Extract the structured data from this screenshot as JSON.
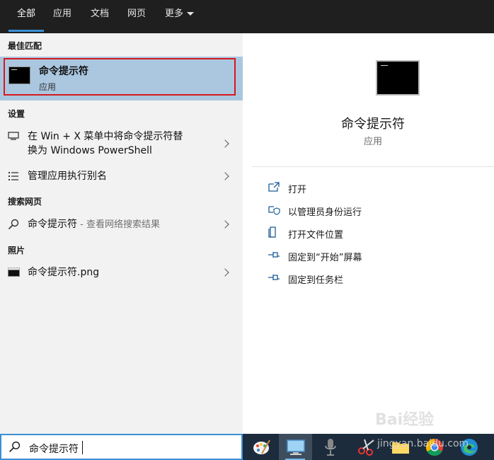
{
  "tabs": [
    {
      "label": "全部",
      "active": true
    },
    {
      "label": "应用"
    },
    {
      "label": "文档"
    },
    {
      "label": "网页"
    },
    {
      "label": "更多"
    }
  ],
  "sections": {
    "best_match": "最佳匹配",
    "settings": "设置",
    "web_search": "搜索网页",
    "photos": "照片"
  },
  "best_match": {
    "title": "命令提示符",
    "subtitle": "应用"
  },
  "settings_items": [
    {
      "line1": "在 Win + X 菜单中将命令提示符替",
      "line2": "换为 Windows PowerShell"
    },
    {
      "line1": "管理应用执行别名"
    }
  ],
  "web_item": {
    "label": "命令提示符",
    "hint": " - 查看网络搜索结果"
  },
  "photo_item": {
    "label": "命令提示符.png"
  },
  "preview": {
    "title": "命令提示符",
    "subtitle": "应用",
    "actions": [
      {
        "label": "打开",
        "icon": "open-icon"
      },
      {
        "label": "以管理员身份运行",
        "icon": "shield-icon"
      },
      {
        "label": "打开文件位置",
        "icon": "file-location-icon"
      },
      {
        "label": "固定到“开始”屏幕",
        "icon": "pin-icon"
      },
      {
        "label": "固定到任务栏",
        "icon": "pin-icon"
      }
    ]
  },
  "search": {
    "value": "命令提示符"
  },
  "taskbar": [
    "paint-icon",
    "desktop-icon",
    "microphone-icon",
    "scissors-icon",
    "folder-icon",
    "chrome-icon",
    "edge-icon"
  ],
  "watermark": {
    "line1": "Bai经验",
    "line2": "jingyan.baidu.com"
  },
  "colors": {
    "accent": "#3b8fd6",
    "selected": "#abc7e0",
    "highlight_border": "#d4191c"
  }
}
